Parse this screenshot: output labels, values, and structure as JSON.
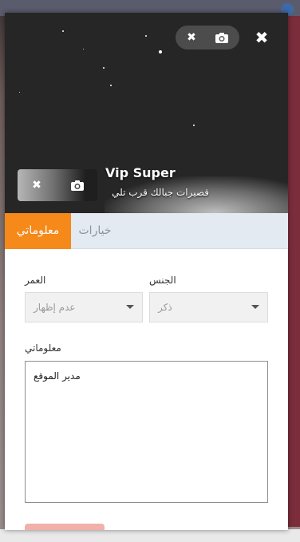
{
  "profile": {
    "name": "Vip Super",
    "status": "قصيرات جبالك قرب تلي"
  },
  "tabs": [
    {
      "label": "معلوماتي",
      "active": true
    },
    {
      "label": "خيارات",
      "active": false
    }
  ],
  "form": {
    "age_label": "العمر",
    "age_value": "عدم إظهار",
    "gender_label": "الجنس",
    "gender_value": "ذكر",
    "info_label": "معلوماتي",
    "info_value": "مدير الموقع"
  },
  "colors": {
    "accent": "#f5891a",
    "cover": "#262626",
    "save_button": "#f2b0ab"
  },
  "icons": {
    "close": "close-icon",
    "remove": "remove-icon",
    "camera": "camera-icon",
    "dropdown": "chevron-down-icon"
  }
}
